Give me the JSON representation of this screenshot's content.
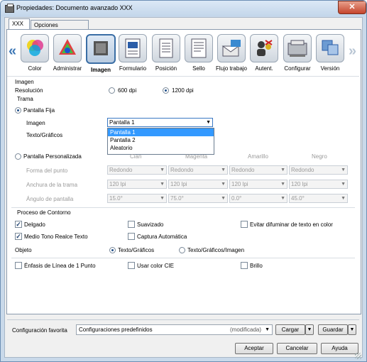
{
  "window": {
    "title": "Propiedades: Documento avanzado XXX",
    "close_glyph": "✕"
  },
  "tabs": [
    {
      "label": "XXX"
    },
    {
      "label": "Opciones avanzadas"
    }
  ],
  "toolbar": {
    "prev_glyph": "«",
    "next_glyph": "»",
    "items": [
      {
        "label": "Color",
        "icon": "color-wheel-icon"
      },
      {
        "label": "Administrar",
        "icon": "color-management-icon"
      },
      {
        "label": "Imagen",
        "icon": "image-icon",
        "selected": true
      },
      {
        "label": "Formulario",
        "icon": "form-icon"
      },
      {
        "label": "Posición",
        "icon": "position-icon"
      },
      {
        "label": "Sello",
        "icon": "stamp-icon"
      },
      {
        "label": "Flujo trabajo",
        "icon": "workflow-icon"
      },
      {
        "label": "Autent.",
        "icon": "authentication-icon"
      },
      {
        "label": "Configurar",
        "icon": "printer-config-icon"
      },
      {
        "label": "Versión",
        "icon": "version-icon"
      }
    ]
  },
  "imagen": {
    "section_label": "Imagen",
    "resolucion_label": "Resolución",
    "res_600": "600 dpi",
    "res_1200": "1200 dpi",
    "res_selected": "1200 dpi"
  },
  "trama": {
    "section_label": "Trama",
    "pantalla_fija_label": "Pantalla Fija",
    "imagen_label": "Imagen",
    "imagen_value": "Pantalla 1",
    "texto_graficos_label": "Texto/Gráficos",
    "dropdown_options": [
      "Pantalla 1",
      "Pantalla 2",
      "Aleatorio"
    ],
    "dropdown_highlight": "Pantalla 1",
    "pantalla_personalizada_label": "Pantalla Personalizada",
    "columns": [
      "Cian",
      "Magenta",
      "Amarillo",
      "Negro"
    ],
    "rows": [
      {
        "label": "Forma del punto",
        "values": [
          "Redondo",
          "Redondo",
          "Redondo",
          "Redondo"
        ]
      },
      {
        "label": "Anchura de la trama",
        "values": [
          "120 lpi",
          "120 lpi",
          "120 lpi",
          "120 lpi"
        ]
      },
      {
        "label": "Ángulo de pantalla",
        "values": [
          "15.0°",
          "75.0°",
          "0.0°",
          "45.0°"
        ]
      }
    ]
  },
  "contorno": {
    "section_label": "Proceso de Contorno",
    "delgado": "Delgado",
    "suavizado": "Suavizado",
    "evitar": "Evitar difuminar de texto en color",
    "medio_tono": "Medio Tono Realce Texto",
    "captura": "Captura Automática",
    "objeto_label": "Objeto",
    "obj_texto": "Texto/Gráficos",
    "obj_texto_imagen": "Texto/Gráficos/Imagen"
  },
  "extras": {
    "enfasis": "Énfasis de Línea de 1 Punto",
    "cie": "Usar color CIE",
    "brillo": "Brillo"
  },
  "favoritos": {
    "label": "Configuración favorita",
    "value": "Configuraciones predefinidos",
    "state": "(modificada)",
    "cargar": "Cargar",
    "guardar": "Guardar"
  },
  "buttons": {
    "aceptar": "Aceptar",
    "cancelar": "Cancelar",
    "ayuda": "Ayuda"
  }
}
